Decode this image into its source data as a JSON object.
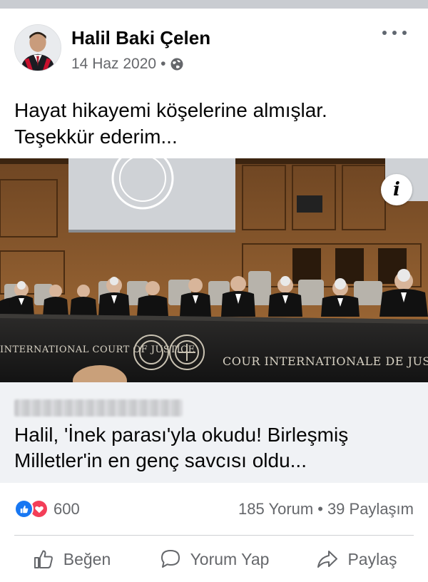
{
  "post": {
    "author": "Halil Baki Çelen",
    "date": "14 Haz 2020",
    "separator": "•",
    "privacy_icon": "globe-icon",
    "more_icon": "more-options-icon",
    "text_lines": [
      "Hayat hikayemi köşelerine almışlar.",
      "Teşekkür ederim..."
    ]
  },
  "link": {
    "image_caption_left": "INTERNATIONAL COURT OF JUSTICE",
    "image_caption_right": "COUR INTERNATIONALE DE JUSTICE",
    "info_label": "i",
    "title_lines": [
      "Halil, 'İnek parası'yla okudu! Birleşmiş",
      "Milletler'in en genç savcısı oldu..."
    ]
  },
  "stats": {
    "reaction_icons": [
      "like-reaction-icon",
      "love-reaction-icon"
    ],
    "reaction_count": "600",
    "comments": "185 Yorum",
    "dot": "•",
    "shares": "39 Paylaşım"
  },
  "actions": {
    "like": "Beğen",
    "comment": "Yorum Yap",
    "share": "Paylaş"
  },
  "colors": {
    "like_blue": "#1877f2",
    "love_red": "#f33e58",
    "secondary_text": "#65676b",
    "link_card_bg": "#f0f2f5"
  }
}
